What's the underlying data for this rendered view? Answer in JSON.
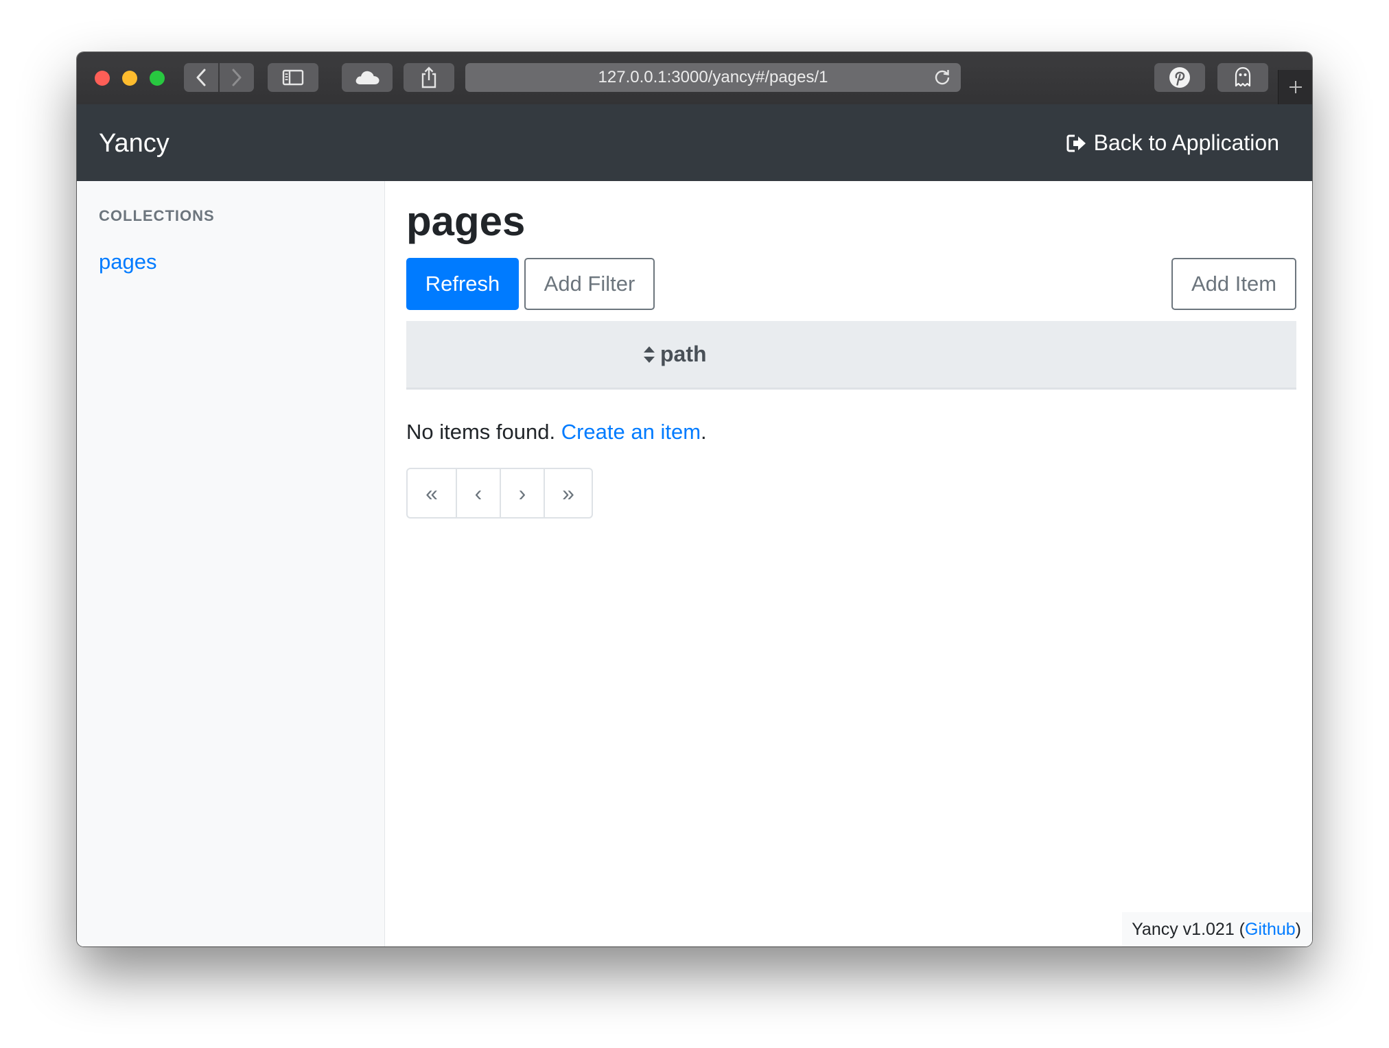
{
  "browser": {
    "url": "127.0.0.1:3000/yancy#/pages/1"
  },
  "navbar": {
    "brand": "Yancy",
    "back_link": "Back to Application"
  },
  "sidebar": {
    "heading": "COLLECTIONS",
    "items": [
      {
        "label": "pages"
      }
    ]
  },
  "main": {
    "title": "pages",
    "buttons": {
      "refresh": "Refresh",
      "add_filter": "Add Filter",
      "add_item": "Add Item"
    },
    "table": {
      "columns": [
        {
          "label": "path",
          "sortable": true
        }
      ],
      "rows": []
    },
    "empty": {
      "message": "No items found. ",
      "link": "Create an item",
      "suffix": "."
    },
    "pagination": {
      "first": "«",
      "prev": "‹",
      "next": "›",
      "last": "»"
    }
  },
  "footer": {
    "version": "Yancy v1.021 (",
    "link": "Github",
    "suffix": ")"
  },
  "colors": {
    "navbar_bg": "#343a40",
    "primary": "#007bff",
    "secondary": "#6c757d",
    "sidebar_bg": "#f8f9fa",
    "table_head_bg": "#e9ecef"
  }
}
